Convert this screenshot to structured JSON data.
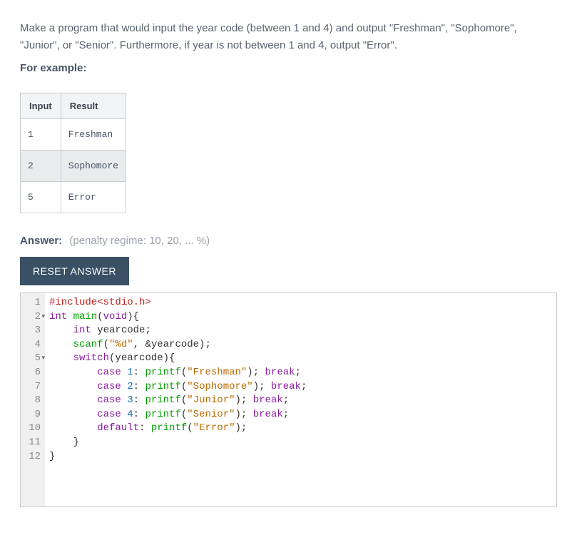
{
  "description": {
    "para1": "Make a program that would input the year code (between 1 and 4) and output \"Freshman\", \"Sophomore\", \"Junior\", or \"Senior\". Furthermore, if year is not between 1 and 4, output \"Error\".",
    "example_label": "For example:"
  },
  "table": {
    "headers": [
      "Input",
      "Result"
    ],
    "rows": [
      {
        "input": "1",
        "result": "Freshman"
      },
      {
        "input": "2",
        "result": "Sophomore"
      },
      {
        "input": "5",
        "result": "Error"
      }
    ]
  },
  "answer": {
    "label": "Answer:",
    "penalty": "(penalty regime: 10, 20, ... %)"
  },
  "buttons": {
    "reset": "RESET ANSWER"
  },
  "code": {
    "line_numbers": [
      "1",
      "2",
      "3",
      "4",
      "5",
      "6",
      "7",
      "8",
      "9",
      "10",
      "11",
      "12"
    ],
    "fold_lines": [
      2,
      5
    ],
    "tokens": {
      "l1_hash": "#include",
      "l1_inc": "<stdio.h>",
      "l2_int": "int",
      "l2_main": "main",
      "l2_void": "void",
      "l2_rest": "){",
      "l3_int": "int",
      "l3_rest": " yearcode;",
      "l4_scanf": "scanf",
      "l4_str": "\"%d\"",
      "l4_rest": ", &yearcode);",
      "l5_switch": "switch",
      "l5_rest": "(yearcode){",
      "l6_case": "case",
      "l6_n": "1",
      "l6_printf": "printf",
      "l6_str": "\"Freshman\"",
      "l6_break": "break",
      "l7_case": "case",
      "l7_n": "2",
      "l7_printf": "printf",
      "l7_str": "\"Sophomore\"",
      "l7_break": "break",
      "l8_case": "case",
      "l8_n": "3",
      "l8_printf": "printf",
      "l8_str": "\"Junior\"",
      "l8_break": "break",
      "l9_case": "case",
      "l9_n": "4",
      "l9_printf": "printf",
      "l9_str": "\"Senior\"",
      "l9_break": "break",
      "l10_default": "default",
      "l10_printf": "printf",
      "l10_str": "\"Error\"",
      "l11": "    }",
      "l12": "}"
    }
  }
}
